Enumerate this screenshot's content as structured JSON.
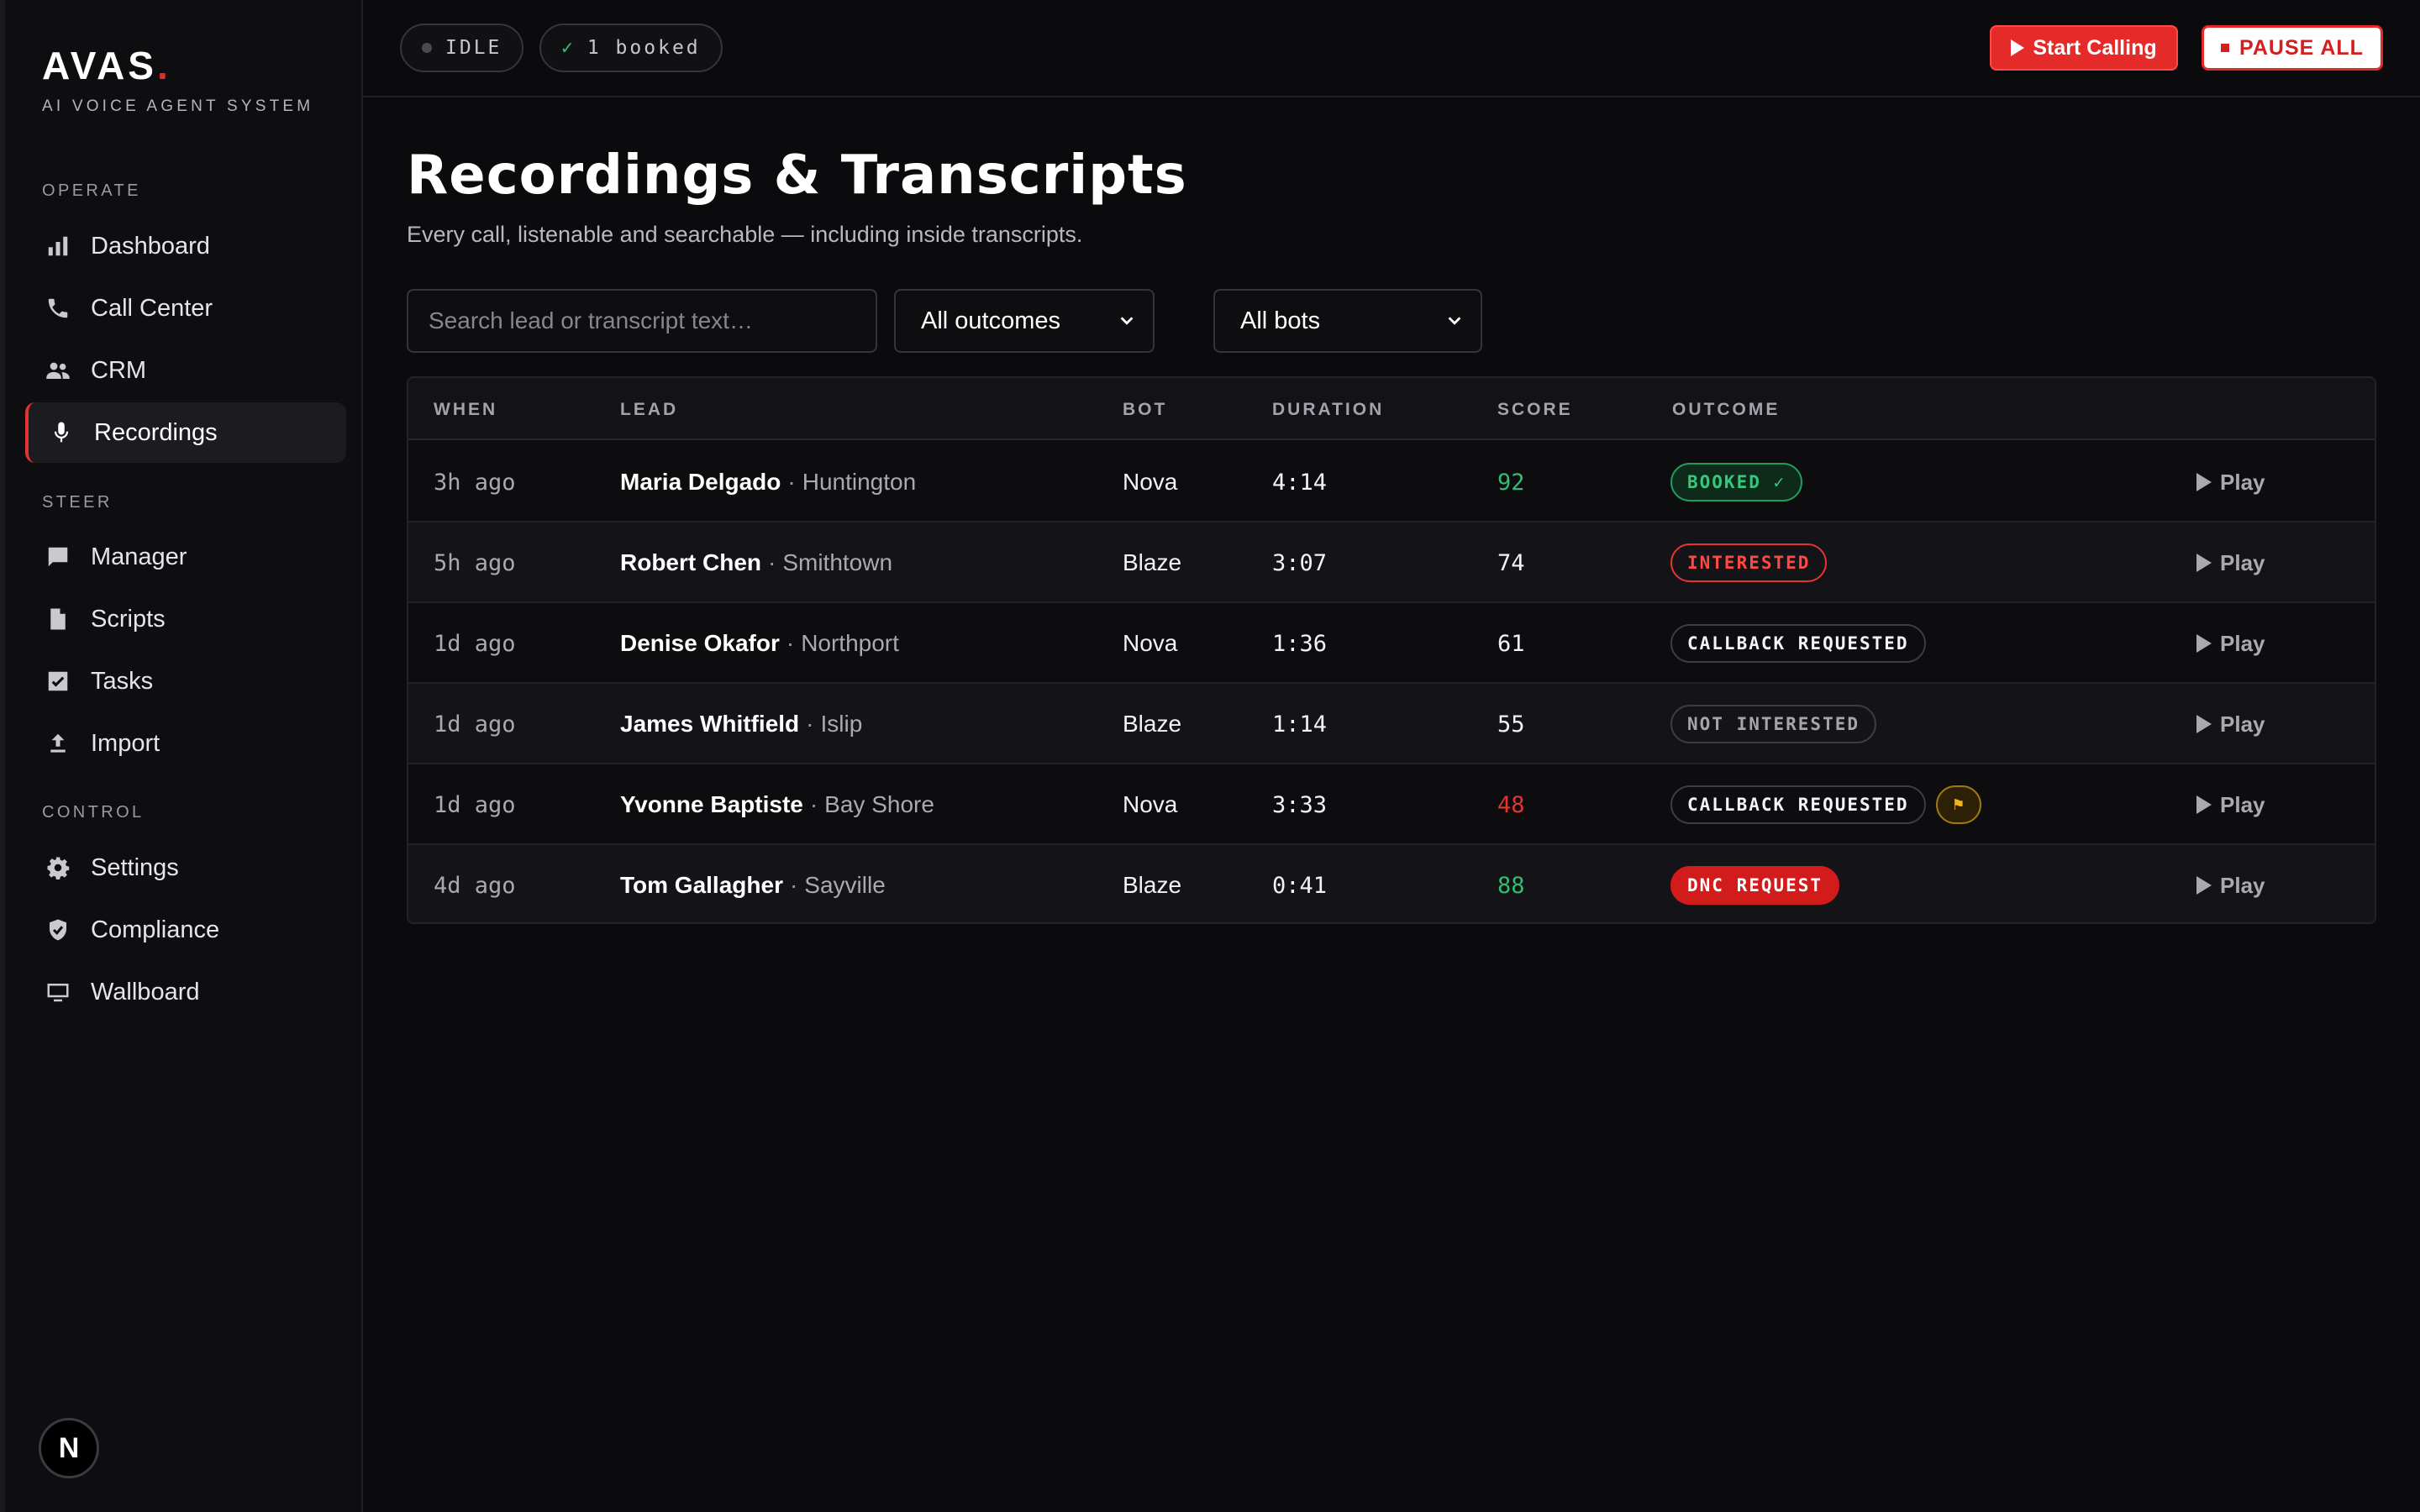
{
  "brand": {
    "name": "AVAS",
    "dot": ".",
    "subtitle": "AI VOICE AGENT SYSTEM"
  },
  "sidebar": {
    "sections": [
      {
        "label": "OPERATE",
        "items": [
          {
            "label": "Dashboard",
            "icon": "bar-chart-icon",
            "active": false
          },
          {
            "label": "Call Center",
            "icon": "phone-icon",
            "active": false
          },
          {
            "label": "CRM",
            "icon": "people-icon",
            "active": false
          },
          {
            "label": "Recordings",
            "icon": "microphone-icon",
            "active": true
          }
        ]
      },
      {
        "label": "STEER",
        "items": [
          {
            "label": "Manager",
            "icon": "chat-bubble-icon",
            "active": false
          },
          {
            "label": "Scripts",
            "icon": "document-icon",
            "active": false
          },
          {
            "label": "Tasks",
            "icon": "checkbox-icon",
            "active": false
          },
          {
            "label": "Import",
            "icon": "upload-icon",
            "active": false
          }
        ]
      },
      {
        "label": "CONTROL",
        "items": [
          {
            "label": "Settings",
            "icon": "gear-icon",
            "active": false
          },
          {
            "label": "Compliance",
            "icon": "shield-check-icon",
            "active": false
          },
          {
            "label": "Wallboard",
            "icon": "monitor-icon",
            "active": false
          }
        ]
      }
    ],
    "avatar_letter": "N"
  },
  "topbar": {
    "status_pill": "IDLE",
    "booked_check": "✓",
    "booked_pill": "1 booked",
    "start_button": "Start Calling",
    "pause_button": "PAUSE ALL"
  },
  "page": {
    "title": "Recordings & Transcripts",
    "subtitle": "Every call, listenable and searchable — including inside transcripts."
  },
  "filters": {
    "search_placeholder": "Search lead or transcript text…",
    "search_value": "",
    "outcome_selected": "All outcomes",
    "bot_selected": "All bots"
  },
  "table": {
    "columns": [
      "WHEN",
      "LEAD",
      "BOT",
      "DURATION",
      "SCORE",
      "OUTCOME"
    ],
    "play_label": "Play",
    "rows": [
      {
        "when": "3h ago",
        "name": "Maria Delgado",
        "sep": "·",
        "city": "Huntington",
        "bot": "Nova",
        "duration": "4:14",
        "score": "92",
        "score_color": "#2fbf6f",
        "outcome": "BOOKED ✓",
        "outcome_style": "booked",
        "flag": false
      },
      {
        "when": "5h ago",
        "name": "Robert Chen",
        "sep": "·",
        "city": "Smithtown",
        "bot": "Blaze",
        "duration": "3:07",
        "score": "74",
        "score_color": "#f3f3f5",
        "outcome": "INTERESTED",
        "outcome_style": "interested",
        "flag": false
      },
      {
        "when": "1d ago",
        "name": "Denise Okafor",
        "sep": "·",
        "city": "Northport",
        "bot": "Nova",
        "duration": "1:36",
        "score": "61",
        "score_color": "#f3f3f5",
        "outcome": "CALLBACK REQUESTED",
        "outcome_style": "callback",
        "flag": false
      },
      {
        "when": "1d ago",
        "name": "James Whitfield",
        "sep": "·",
        "city": "Islip",
        "bot": "Blaze",
        "duration": "1:14",
        "score": "55",
        "score_color": "#f3f3f5",
        "outcome": "NOT INTERESTED",
        "outcome_style": "not-interested",
        "flag": false
      },
      {
        "when": "1d ago",
        "name": "Yvonne Baptiste",
        "sep": "·",
        "city": "Bay Shore",
        "bot": "Nova",
        "duration": "3:33",
        "score": "48",
        "score_color": "#e5342f",
        "outcome": "CALLBACK REQUESTED",
        "outcome_style": "callback",
        "flag": true,
        "flag_glyph": "⚑"
      },
      {
        "when": "4d ago",
        "name": "Tom Gallagher",
        "sep": "·",
        "city": "Sayville",
        "bot": "Blaze",
        "duration": "0:41",
        "score": "88",
        "score_color": "#2fbf6f",
        "outcome": "DNC REQUEST",
        "outcome_style": "dnc",
        "flag": false
      }
    ]
  },
  "colors": {
    "accent_red": "#e52a2a",
    "booked_green": "#2fbf6f",
    "flag_amber": "#f0b51d"
  }
}
